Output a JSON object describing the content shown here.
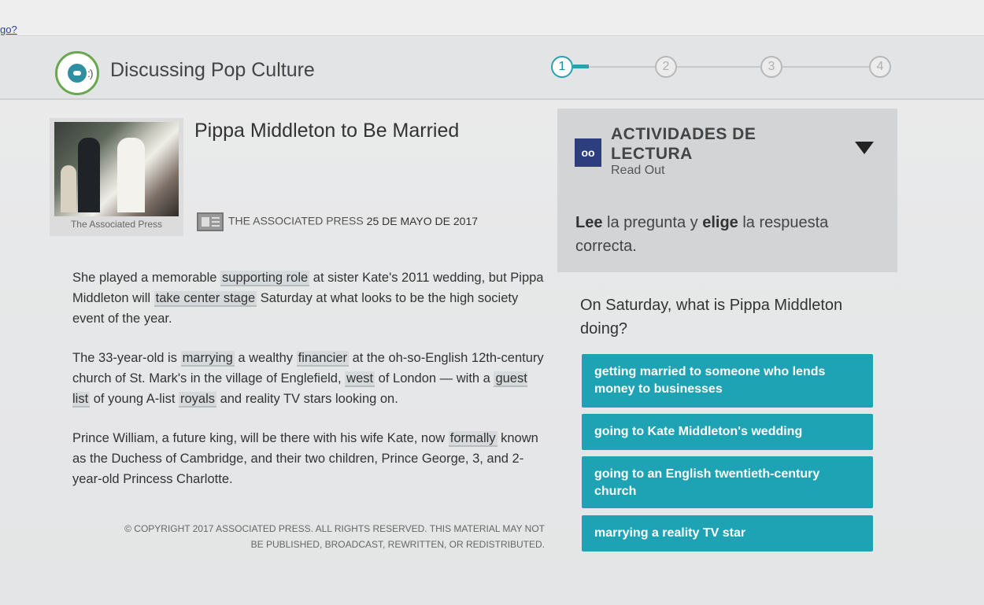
{
  "topbar": {
    "link_text": "go?"
  },
  "header": {
    "lesson_title": "Discussing Pop Culture",
    "steps": [
      "1",
      "2",
      "3",
      "4"
    ],
    "current_step": 1
  },
  "article": {
    "title": "Pippa Middleton to Be Married",
    "photo_credit": "The Associated Press",
    "source": "THE ASSOCIATED PRESS",
    "date": "25 DE MAYO DE 2017",
    "p1": {
      "t1": "She played a memorable ",
      "v1": "supporting role",
      "t2": " at sister Kate's 2011 wedding, but Pippa Middleton will ",
      "v2": "take center stage",
      "t3": " Saturday at what looks to be the high society event of the year."
    },
    "p2": {
      "t1": "The 33-year-old is ",
      "v1": "marrying",
      "t2": " a wealthy ",
      "v2": "financier",
      "t3": " at the oh-so-English 12th-century church of St. Mark's in the village of Englefield, ",
      "v3": "west",
      "t4": " of London — with a ",
      "v4": "guest list",
      "t5": " of young A-list ",
      "v5": "royals",
      "t6": " and reality TV stars looking on."
    },
    "p3": {
      "t1": "Prince William, a future king, will be there with his wife Kate, now ",
      "v1": "formally",
      "t2": " known as the Duchess of Cambridge, and their two children, Prince George, 3, and 2-year-old Princess Charlotte."
    },
    "copyright_line1": "© COPYRIGHT 2017 ASSOCIATED PRESS. ALL RIGHTS RESERVED. THIS MATERIAL MAY NOT",
    "copyright_line2": "BE PUBLISHED, BROADCAST, REWRITTEN, OR REDISTRIBUTED."
  },
  "activity": {
    "title": "ACTIVIDADES DE LECTURA",
    "subtitle": "Read Out",
    "instruction": {
      "w1": "Lee",
      "w2": " la pregunta y ",
      "w3": "elige",
      "w4": " la respuesta correcta."
    },
    "question": "On Saturday, what is Pippa Middleton doing?",
    "answers": [
      "getting married to someone who lends money to businesses",
      "going to Kate Middleton's wedding",
      "going to an English twentieth-century church",
      "marrying a reality TV star"
    ]
  },
  "colors": {
    "accent": "#1ea3b5",
    "lesson_ring": "#69a84f",
    "icon_blue": "#2c3e80"
  }
}
